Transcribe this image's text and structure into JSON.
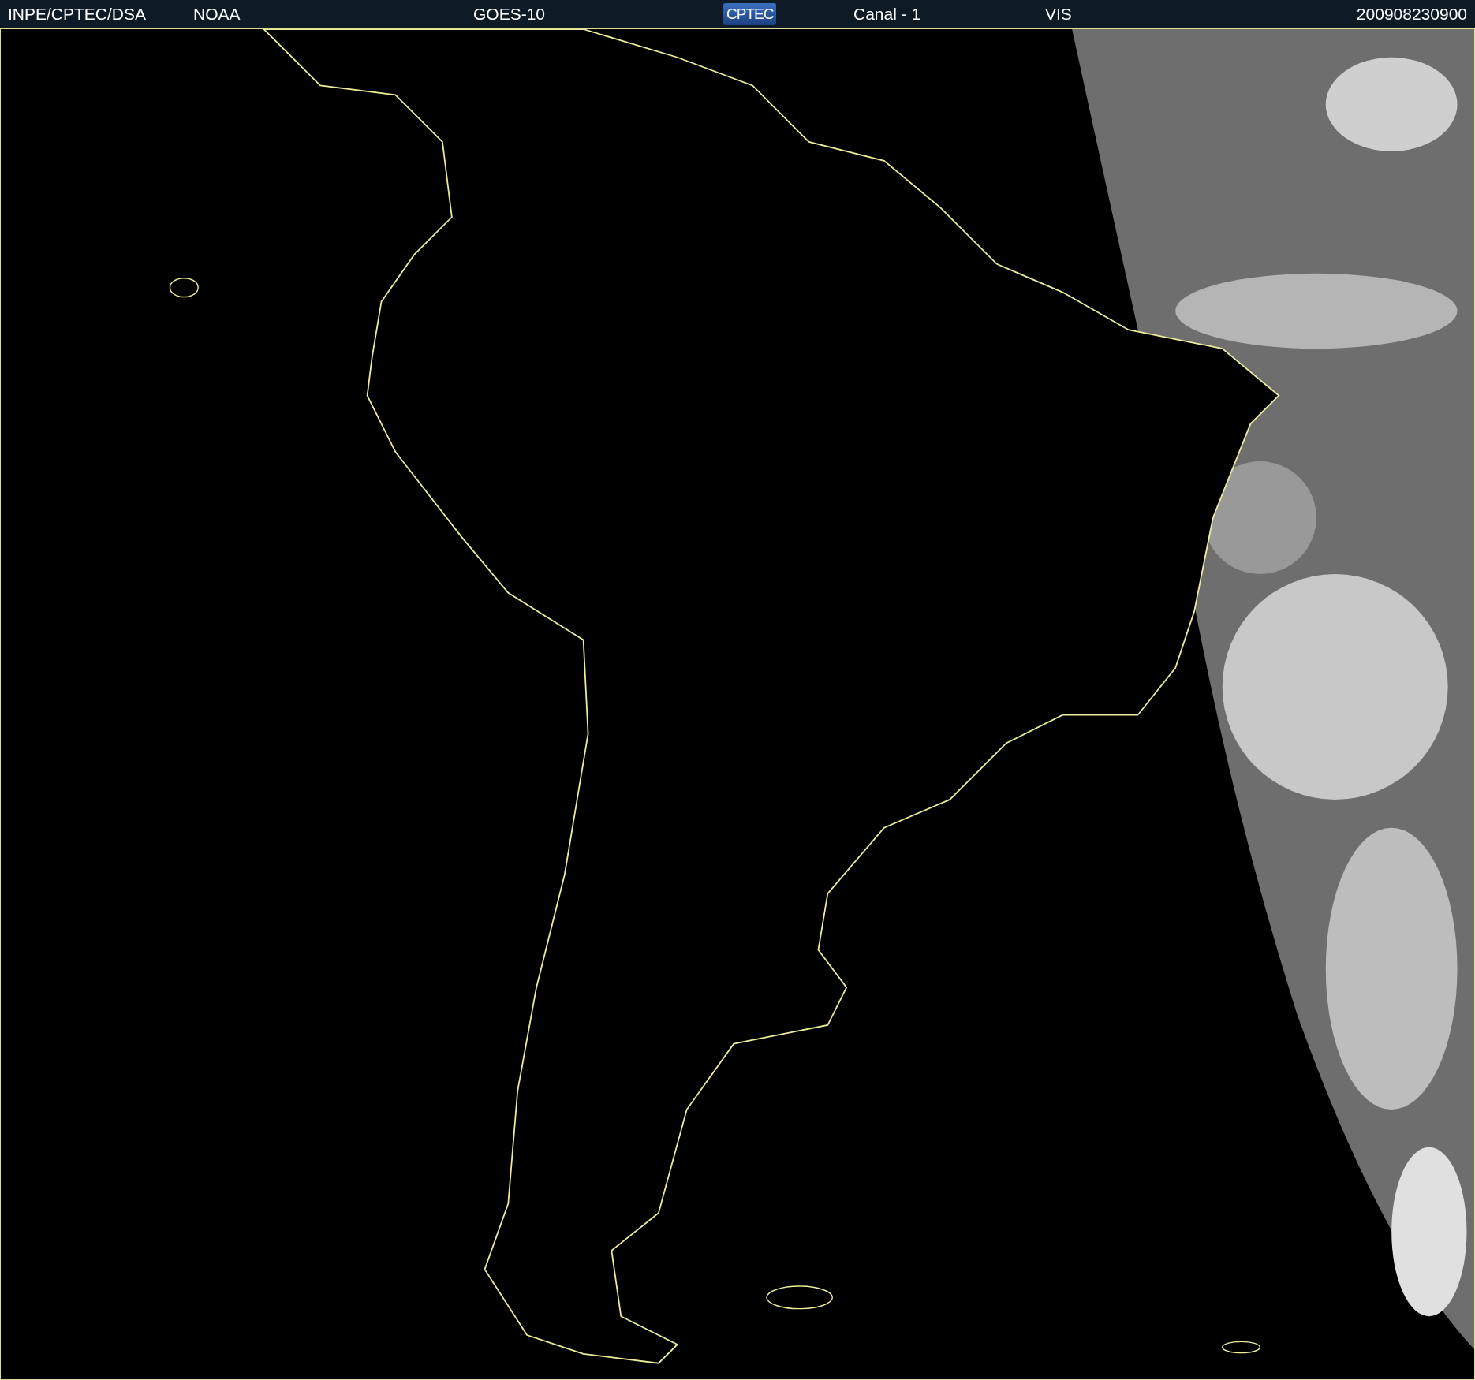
{
  "header": {
    "items": [
      {
        "text": "INPE/CPTEC/DSA",
        "kind": "label"
      },
      {
        "text": "NOAA",
        "kind": "label"
      },
      {
        "text": "GOES-10",
        "kind": "label"
      },
      {
        "text": "CPTEC",
        "kind": "logo"
      },
      {
        "text": "Canal - 1",
        "kind": "label"
      },
      {
        "text": "VIS",
        "kind": "label"
      },
      {
        "text": "200908230900",
        "kind": "date"
      }
    ]
  }
}
